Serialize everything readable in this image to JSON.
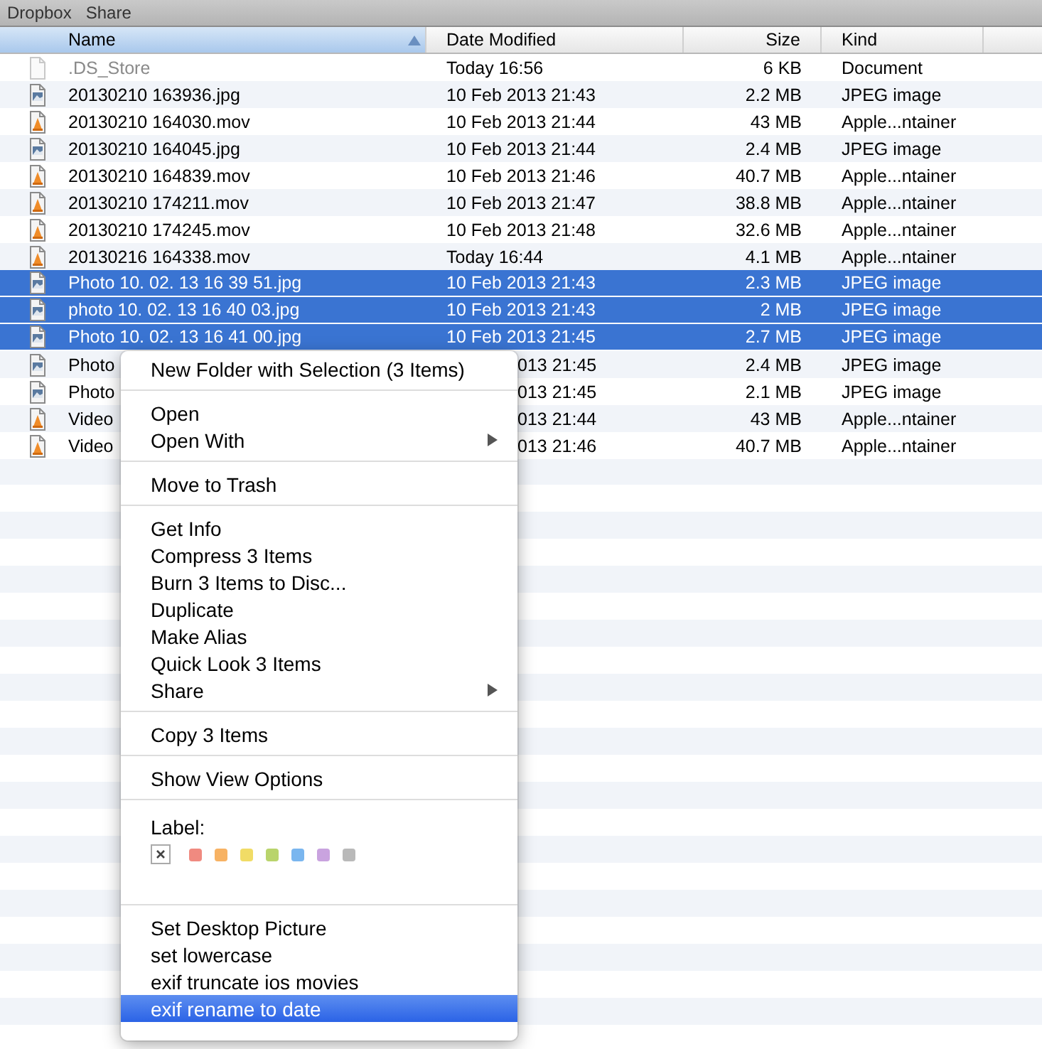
{
  "toolbar": {
    "buttons": [
      "Dropbox",
      "Share"
    ]
  },
  "columns": [
    {
      "label": "Name",
      "selected": true,
      "sorted": true
    },
    {
      "label": "Date Modified",
      "selected": false,
      "sorted": false
    },
    {
      "label": "Size",
      "selected": false,
      "sorted": false
    },
    {
      "label": "Kind",
      "selected": false,
      "sorted": false
    }
  ],
  "rows": [
    {
      "kind": "document",
      "name": ".DS_Store",
      "date": "Today 16:56",
      "size": "6 KB",
      "file_type": "Document",
      "selected": false,
      "hidden_file": true
    },
    {
      "kind": "image",
      "name": "20130210 163936.jpg",
      "date": "10 Feb 2013 21:43",
      "size": "2.2 MB",
      "file_type": "JPEG image",
      "selected": false
    },
    {
      "kind": "movie",
      "name": "20130210 164030.mov",
      "date": "10 Feb 2013 21:44",
      "size": "43 MB",
      "file_type": "Apple...ntainer",
      "selected": false
    },
    {
      "kind": "image",
      "name": "20130210 164045.jpg",
      "date": "10 Feb 2013 21:44",
      "size": "2.4 MB",
      "file_type": "JPEG image",
      "selected": false
    },
    {
      "kind": "movie",
      "name": "20130210 164839.mov",
      "date": "10 Feb 2013 21:46",
      "size": "40.7 MB",
      "file_type": "Apple...ntainer",
      "selected": false
    },
    {
      "kind": "movie",
      "name": "20130210 174211.mov",
      "date": "10 Feb 2013 21:47",
      "size": "38.8 MB",
      "file_type": "Apple...ntainer",
      "selected": false
    },
    {
      "kind": "movie",
      "name": "20130210 174245.mov",
      "date": "10 Feb 2013 21:48",
      "size": "32.6 MB",
      "file_type": "Apple...ntainer",
      "selected": false
    },
    {
      "kind": "movie",
      "name": "20130216 164338.mov",
      "date": "Today 16:44",
      "size": "4.1 MB",
      "file_type": "Apple...ntainer",
      "selected": false
    },
    {
      "kind": "image",
      "name": "Photo 10. 02. 13 16 39 51.jpg",
      "date": "10 Feb 2013 21:43",
      "size": "2.3 MB",
      "file_type": "JPEG image",
      "selected": true
    },
    {
      "kind": "image",
      "name": "photo 10. 02. 13 16 40 03.jpg",
      "date": "10 Feb 2013 21:43",
      "size": "2 MB",
      "file_type": "JPEG image",
      "selected": true
    },
    {
      "kind": "image",
      "name": "Photo 10. 02. 13 16 41 00.jpg",
      "date": "10 Feb 2013 21:45",
      "size": "2.7 MB",
      "file_type": "JPEG image",
      "selected": true
    },
    {
      "kind": "image",
      "name": "Photo",
      "date": "013 21:45",
      "size": "2.4 MB",
      "file_type": "JPEG image",
      "selected": false,
      "under_menu": true
    },
    {
      "kind": "image",
      "name": "Photo",
      "date": "013 21:45",
      "size": "2.1 MB",
      "file_type": "JPEG image",
      "selected": false,
      "under_menu": true
    },
    {
      "kind": "movie",
      "name": "Video",
      "date": "013 21:44",
      "size": "43 MB",
      "file_type": "Apple...ntainer",
      "selected": false,
      "under_menu": true
    },
    {
      "kind": "movie",
      "name": "Video",
      "date": "013 21:46",
      "size": "40.7 MB",
      "file_type": "Apple...ntainer",
      "selected": false,
      "under_menu": true
    }
  ],
  "context_menu": {
    "sections": [
      {
        "kind": "items",
        "items": [
          {
            "label": "New Folder with Selection (3 Items)",
            "submenu": false,
            "selected": false
          }
        ]
      },
      {
        "kind": "items",
        "items": [
          {
            "label": "Open",
            "submenu": false,
            "selected": false
          },
          {
            "label": "Open With",
            "submenu": true,
            "selected": false
          }
        ]
      },
      {
        "kind": "items",
        "items": [
          {
            "label": "Move to Trash",
            "submenu": false,
            "selected": false
          }
        ]
      },
      {
        "kind": "items",
        "items": [
          {
            "label": "Get Info",
            "submenu": false,
            "selected": false
          },
          {
            "label": "Compress 3 Items",
            "submenu": false,
            "selected": false
          },
          {
            "label": "Burn 3 Items to Disc...",
            "submenu": false,
            "selected": false
          },
          {
            "label": "Duplicate",
            "submenu": false,
            "selected": false
          },
          {
            "label": "Make Alias",
            "submenu": false,
            "selected": false
          },
          {
            "label": "Quick Look 3 Items",
            "submenu": false,
            "selected": false
          },
          {
            "label": "Share",
            "submenu": true,
            "selected": false
          }
        ]
      },
      {
        "kind": "items",
        "items": [
          {
            "label": "Copy 3 Items",
            "submenu": false,
            "selected": false
          }
        ]
      },
      {
        "kind": "items",
        "items": [
          {
            "label": "Show View Options",
            "submenu": false,
            "selected": false
          }
        ]
      },
      {
        "kind": "labels",
        "title": "Label:",
        "swatches": [
          {
            "kind": "none"
          },
          {
            "kind": "color",
            "color": "#f08a80"
          },
          {
            "kind": "color",
            "color": "#f7b263"
          },
          {
            "kind": "color",
            "color": "#f1dc66"
          },
          {
            "kind": "color",
            "color": "#b9d46c"
          },
          {
            "kind": "color",
            "color": "#7ab6ef"
          },
          {
            "kind": "color",
            "color": "#c9a3df"
          },
          {
            "kind": "color",
            "color": "#b9b9b9"
          }
        ]
      },
      {
        "kind": "items",
        "items": [
          {
            "label": "Set Desktop Picture",
            "submenu": false,
            "selected": false
          },
          {
            "label": "set lowercase",
            "submenu": false,
            "selected": false
          },
          {
            "label": "exif truncate ios movies",
            "submenu": false,
            "selected": false
          },
          {
            "label": "exif rename to date",
            "submenu": false,
            "selected": true
          }
        ]
      }
    ]
  }
}
